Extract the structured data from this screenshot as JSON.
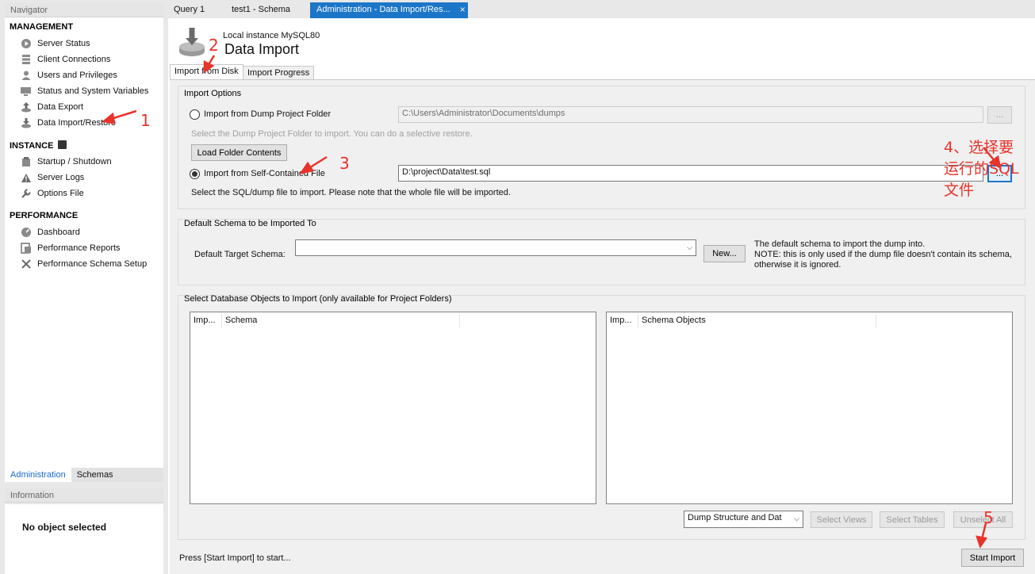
{
  "sidebar": {
    "navigator_title": "Navigator",
    "sections": {
      "management": "MANAGEMENT",
      "instance": "INSTANCE",
      "performance": "PERFORMANCE"
    },
    "management_items": [
      "Server Status",
      "Client Connections",
      "Users and Privileges",
      "Status and System Variables",
      "Data Export",
      "Data Import/Restore"
    ],
    "instance_items": [
      "Startup / Shutdown",
      "Server Logs",
      "Options File"
    ],
    "performance_items": [
      "Dashboard",
      "Performance Reports",
      "Performance Schema Setup"
    ],
    "tabs": [
      "Administration",
      "Schemas"
    ],
    "information_title": "Information",
    "no_object": "No object selected"
  },
  "doc_tabs": [
    "Query 1",
    "test1 - Schema",
    "Administration - Data Import/Res..."
  ],
  "header": {
    "instance": "Local instance MySQL80",
    "title": "Data Import"
  },
  "page_tabs": [
    "Import from Disk",
    "Import Progress"
  ],
  "import_options": {
    "title": "Import Options",
    "dump_folder_label": "Import from Dump Project Folder",
    "dump_folder_path": "C:\\Users\\Administrator\\Documents\\dumps",
    "dump_folder_hint": "Select the Dump Project Folder to import. You can do a selective restore.",
    "load_folder_button": "Load Folder Contents",
    "self_contained_label": "Import from Self-Contained File",
    "self_contained_path": "D:\\project\\Data\\test.sql",
    "self_contained_hint": "Select the SQL/dump file to import. Please note that the whole file will be imported.",
    "browse_label": "..."
  },
  "schema": {
    "title": "Default Schema to be Imported To",
    "target_label": "Default Target Schema:",
    "target_value": "",
    "new_button": "New...",
    "note_line1": "The default schema to import the dump into.",
    "note_line2": "NOTE: this is only used if the dump file doesn't contain its schema,",
    "note_line3": "otherwise it is ignored."
  },
  "objects": {
    "title": "Select Database Objects to Import (only available for Project Folders)",
    "left_cols": [
      "Imp...",
      "Schema"
    ],
    "right_cols": [
      "Imp...",
      "Schema Objects"
    ],
    "dump_mode": "Dump Structure and Dat",
    "select_views": "Select Views",
    "select_tables": "Select Tables",
    "unselect_all": "Unselect All"
  },
  "footer": {
    "status": "Press [Start Import] to start...",
    "start_button": "Start Import"
  },
  "annotations": {
    "a1": "1",
    "a2": "2",
    "a3": "3",
    "a4_line1": "4、选择要",
    "a4_line2": "运行的SQL",
    "a4_line3": "文件",
    "a5": "5"
  },
  "colors": {
    "accent": "#1c76c8",
    "annotation": "#e8332a"
  }
}
